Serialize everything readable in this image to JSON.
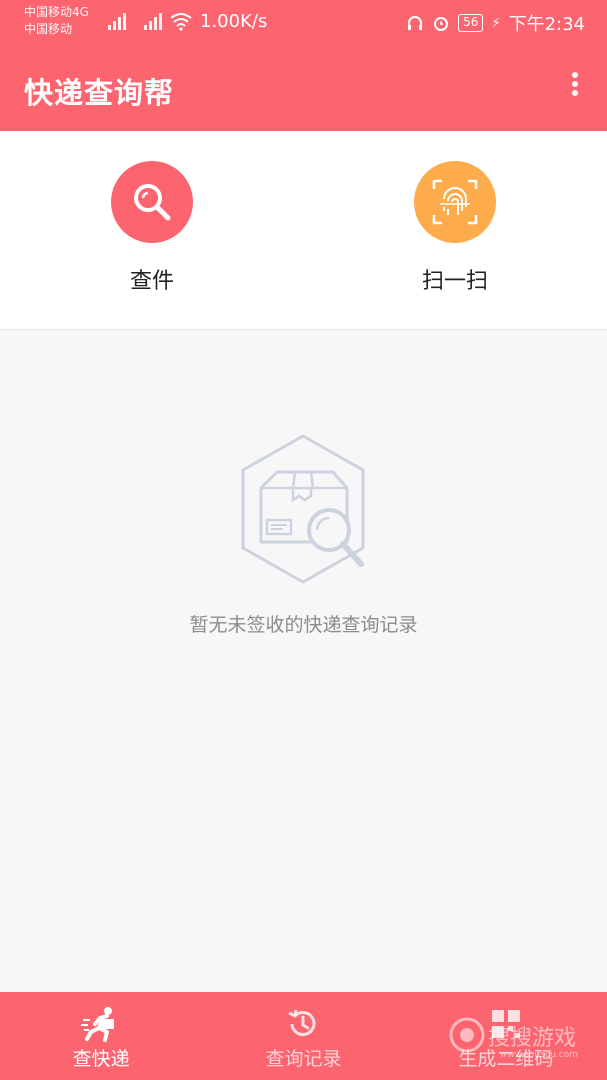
{
  "status_bar": {
    "carrier_line1": "中国移动4G",
    "carrier_line2": "中国移动",
    "net_speed": "1.00K/s",
    "battery": "56",
    "time": "下午2:34"
  },
  "app_bar": {
    "title": "快递查询帮",
    "menu_icon": "more-vertical-icon"
  },
  "actions": [
    {
      "label": "查件",
      "icon": "search-icon",
      "color": "#fc6470"
    },
    {
      "label": "扫一扫",
      "icon": "fingerprint-scan-icon",
      "color": "#fdab4b"
    }
  ],
  "empty_state": {
    "message": "暂无未签收的快递查询记录",
    "icon": "package-search-icon"
  },
  "bottom_nav": [
    {
      "label": "查快递",
      "icon": "courier-runner-icon",
      "active": true
    },
    {
      "label": "查询记录",
      "icon": "history-icon",
      "active": false
    },
    {
      "label": "生成二维码",
      "icon": "qr-code-icon",
      "active": false
    }
  ],
  "watermark": {
    "text": "搜搜游戏",
    "url": "www.sousou.com"
  },
  "colors": {
    "primary": "#fc6470",
    "scan_accent": "#fdab4b",
    "background": "#f7f7f7"
  }
}
